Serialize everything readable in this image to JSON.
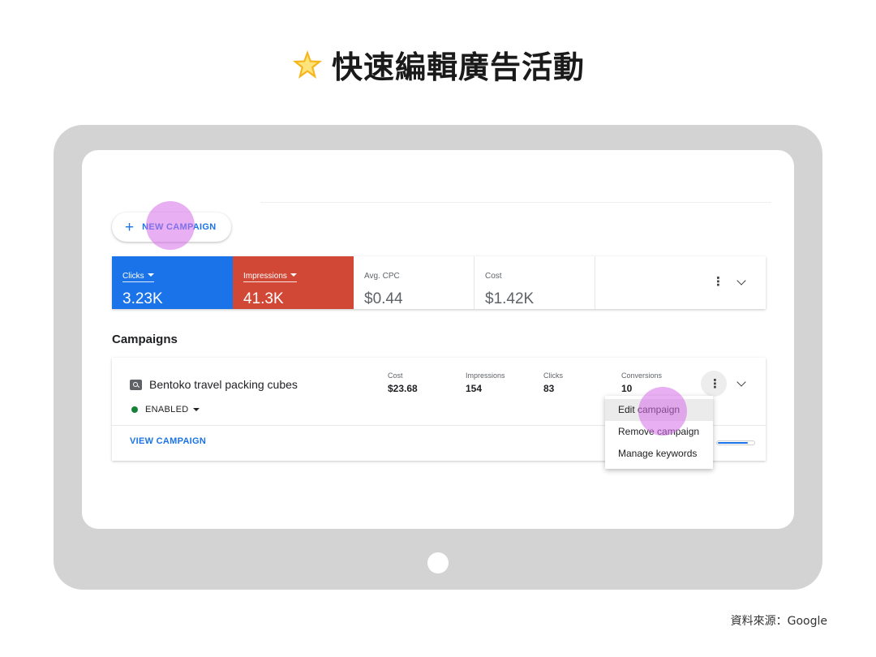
{
  "slide": {
    "title": "快速編輯廣告活動",
    "source": "資料來源：Google"
  },
  "toolbar": {
    "new_campaign_label": "NEW CAMPAIGN"
  },
  "metrics": [
    {
      "label": "Clicks",
      "value": "3.23K",
      "color": "#1a73e8"
    },
    {
      "label": "Impressions",
      "value": "41.3K",
      "color": "#d14836"
    },
    {
      "label": "Avg. CPC",
      "value": "$0.44"
    },
    {
      "label": "Cost",
      "value": "$1.42K"
    }
  ],
  "campaigns": {
    "heading": "Campaigns",
    "item": {
      "name": "Bentoko travel packing cubes",
      "status": "ENABLED",
      "stats": [
        {
          "label": "Cost",
          "value": "$23.68"
        },
        {
          "label": "Impressions",
          "value": "154"
        },
        {
          "label": "Clicks",
          "value": "83"
        },
        {
          "label": "Conversions",
          "value": "10"
        }
      ],
      "view_label": "VIEW CAMPAIGN",
      "budget_progress": 0.85
    }
  },
  "context_menu": {
    "items": [
      "Edit campaign",
      "Remove campaign",
      "Manage keywords"
    ]
  },
  "icons": {
    "title": "star-icon",
    "add": "plus-icon",
    "more": "more-vert-icon",
    "expand": "chevron-down-icon",
    "campaign_type": "search-campaign-icon"
  }
}
